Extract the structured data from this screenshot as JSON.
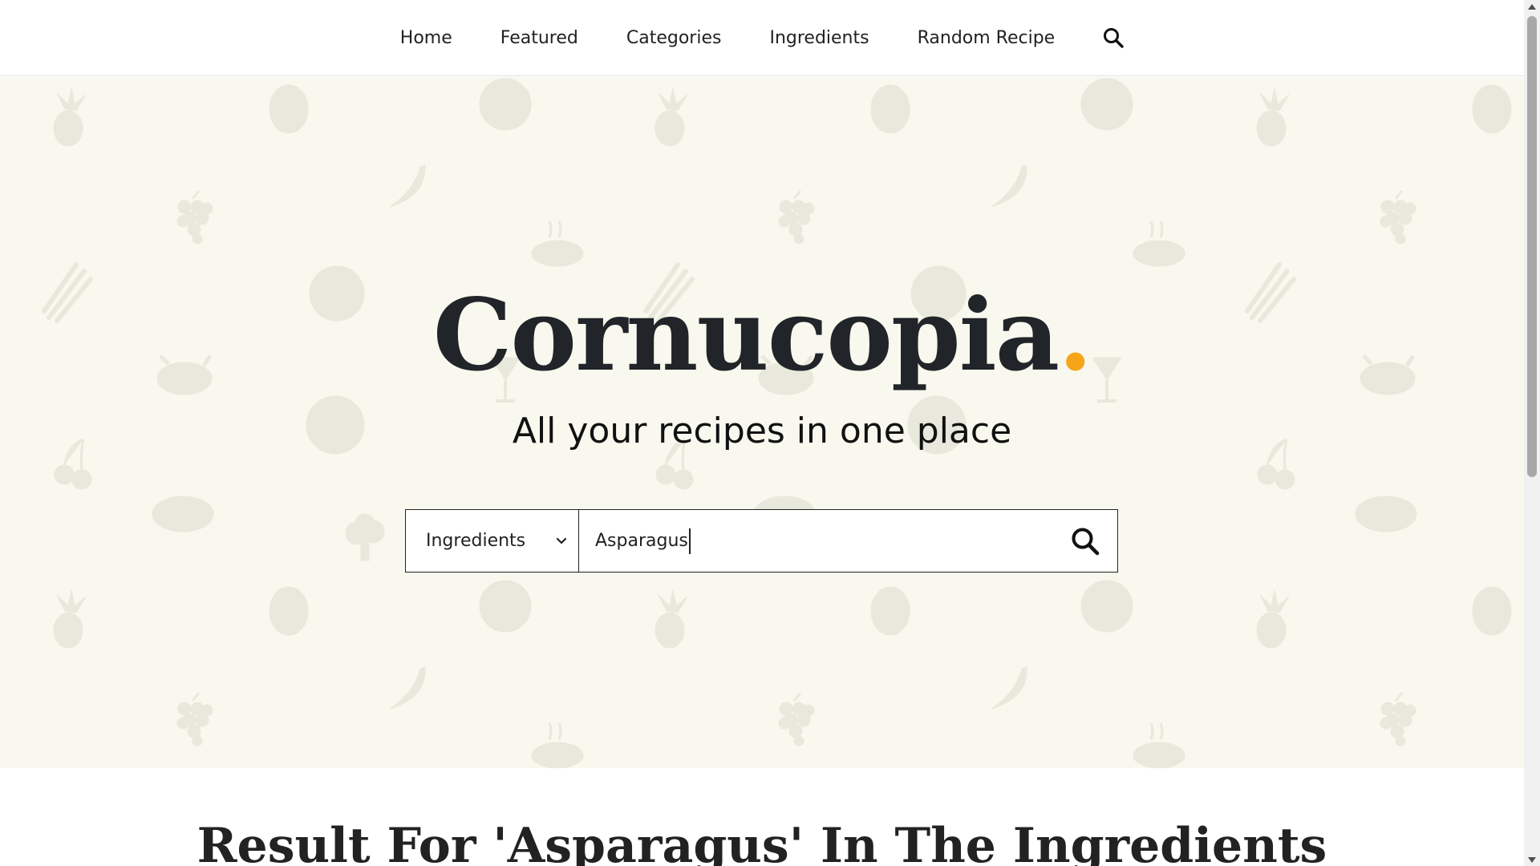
{
  "nav": {
    "items": [
      {
        "label": "Home"
      },
      {
        "label": "Featured"
      },
      {
        "label": "Categories"
      },
      {
        "label": "Ingredients"
      },
      {
        "label": "Random Recipe"
      }
    ],
    "search_icon": "search-icon"
  },
  "hero": {
    "brand": "Cornucopia",
    "brand_dot": ".",
    "tagline": "All your recipes in one place",
    "background_color": "#f8f8ee",
    "accent_color": "#f6a51a"
  },
  "search": {
    "selected_option": "Ingredients",
    "value": "Asparagus",
    "button_icon": "search-icon"
  },
  "results": {
    "title": "Result For 'Asparagus' In The Ingredients"
  }
}
